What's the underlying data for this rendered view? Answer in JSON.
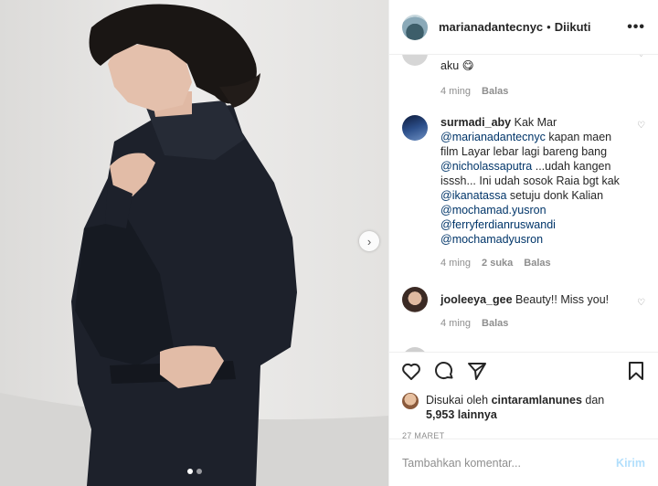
{
  "header": {
    "username": "marianadantecnyc",
    "separator": "•",
    "follow_status": "Diikuti",
    "more_icon": "more-horizontal-icon"
  },
  "comments": [
    {
      "text": "aku 😋",
      "time": "4 ming",
      "reply": "Balas"
    },
    {
      "username": "surmadi_aby",
      "text_parts": [
        {
          "t": "Kak Mar ",
          "m": false
        },
        {
          "t": "@marianadantecnyc",
          "m": true
        },
        {
          "t": " kapan maen film Layar lebar lagi bareng bang ",
          "m": false
        },
        {
          "t": "@nicholassaputra",
          "m": true
        },
        {
          "t": " ...udah kangen isssh... Ini udah sosok Raia bgt kak ",
          "m": false
        },
        {
          "t": "@ikanatassa",
          "m": true
        },
        {
          "t": " setuju donk Kalian ",
          "m": false
        },
        {
          "t": "@mochamad.yusron",
          "m": true
        },
        {
          "t": " ",
          "m": false
        },
        {
          "t": "@ferryferdianruswandi",
          "m": true
        },
        {
          "t": " ",
          "m": false
        },
        {
          "t": "@mochamadyusron",
          "m": true
        }
      ],
      "time": "4 ming",
      "likes": "2 suka",
      "reply": "Balas"
    },
    {
      "username": "jooleeya_gee",
      "text": "Beauty!! Miss you!",
      "time": "4 ming",
      "reply": "Balas"
    }
  ],
  "likes": {
    "prefix": "Disukai oleh",
    "user": "cintaramlanunes",
    "and": "dan",
    "others": "5,953 lainnya"
  },
  "date": "27 MARET",
  "comment_box": {
    "placeholder": "Tambahkan komentar...",
    "post_label": "Kirim"
  },
  "carousel": {
    "slide_count": 2,
    "active_slide": 1
  },
  "colors": {
    "mention": "#003569",
    "post_disabled": "#b2dffc",
    "meta": "#8e8e8e"
  }
}
